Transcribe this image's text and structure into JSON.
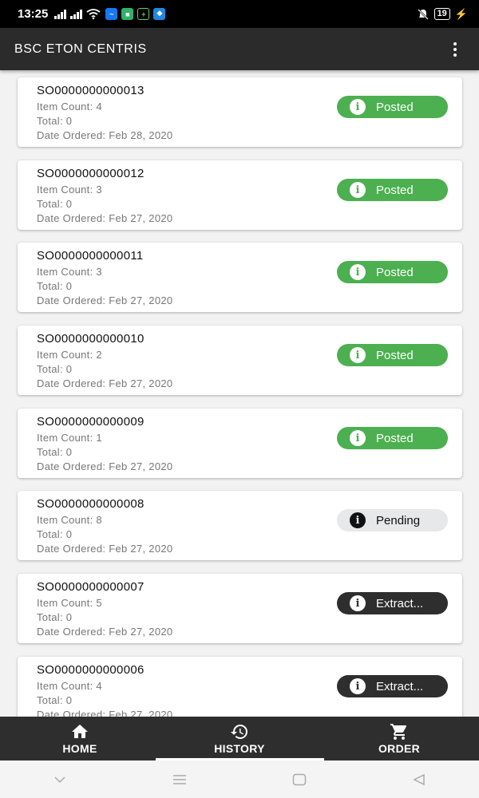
{
  "status": {
    "time": "13:25",
    "battery": "19"
  },
  "app_bar": {
    "title": "BSC ETON CENTRIS"
  },
  "labels": {
    "item_count": "Item Count:",
    "total": "Total:",
    "date_ordered": "Date Ordered:"
  },
  "orders": [
    {
      "so": "SO0000000000013",
      "item_count": "4",
      "total": "0",
      "date": "Feb 28, 2020",
      "status": "Posted",
      "status_type": "posted"
    },
    {
      "so": "SO0000000000012",
      "item_count": "3",
      "total": "0",
      "date": "Feb 27, 2020",
      "status": "Posted",
      "status_type": "posted"
    },
    {
      "so": "SO0000000000011",
      "item_count": "3",
      "total": "0",
      "date": "Feb 27, 2020",
      "status": "Posted",
      "status_type": "posted"
    },
    {
      "so": "SO0000000000010",
      "item_count": "2",
      "total": "0",
      "date": "Feb 27, 2020",
      "status": "Posted",
      "status_type": "posted"
    },
    {
      "so": "SO0000000000009",
      "item_count": "1",
      "total": "0",
      "date": "Feb 27, 2020",
      "status": "Posted",
      "status_type": "posted"
    },
    {
      "so": "SO0000000000008",
      "item_count": "8",
      "total": "0",
      "date": "Feb 27, 2020",
      "status": "Pending",
      "status_type": "pending"
    },
    {
      "so": "SO0000000000007",
      "item_count": "5",
      "total": "0",
      "date": "Feb 27, 2020",
      "status": "Extract...",
      "status_type": "extract"
    },
    {
      "so": "SO0000000000006",
      "item_count": "4",
      "total": "0",
      "date": "Feb 27, 2020",
      "status": "Extract...",
      "status_type": "extract"
    }
  ],
  "bottom_nav": {
    "items": [
      {
        "label": "HOME",
        "icon": "home-icon"
      },
      {
        "label": "HISTORY",
        "icon": "history-icon",
        "active": true
      },
      {
        "label": "ORDER",
        "icon": "cart-icon"
      }
    ]
  },
  "colors": {
    "posted": "#4caf50",
    "pending": "#e6e8ea",
    "extract": "#2e2e2e",
    "app_bar": "#2b2b2b"
  }
}
